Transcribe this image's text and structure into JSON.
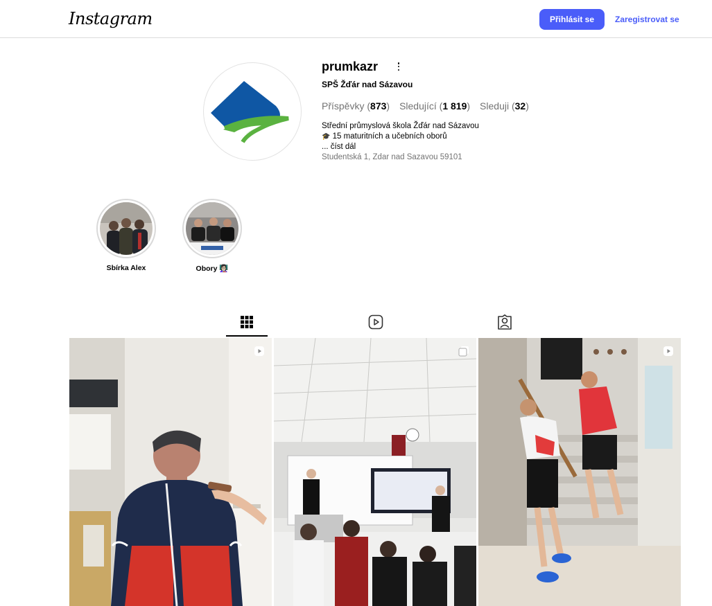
{
  "header": {
    "logo_text": "Instagram",
    "login_label": "Přihlásit se",
    "signup_label": "Zaregistrovat se",
    "accent_color": "#4a5df9"
  },
  "profile": {
    "username": "prumkazr",
    "full_name": "SPŠ Žďár nad Sázavou",
    "stats": {
      "posts_label": "Příspěvky",
      "posts_count": "873",
      "followers_label": "Sledující",
      "followers_count": "1 819",
      "following_label": "Sleduji",
      "following_count": "32"
    },
    "bio": {
      "line1": "Střední průmyslová škola Žďár nad Sázavou",
      "line2_icon": "🎓",
      "line2": "15 maturitních a učebních oborů",
      "more": "... číst dál",
      "address": "Studentská 1, Zdar nad Sazavou 59101"
    }
  },
  "highlights": [
    {
      "label": "Sbírka Alex"
    },
    {
      "label": "Obory 👩🏻‍🏫"
    }
  ],
  "tabs": [
    {
      "name": "posts",
      "icon": "grid-icon",
      "active": true
    },
    {
      "name": "reels",
      "icon": "reels-icon",
      "active": false
    },
    {
      "name": "tagged",
      "icon": "tagged-icon",
      "active": false
    }
  ],
  "posts": [
    {
      "type": "reel",
      "badge_icon": "reel-badge-icon"
    },
    {
      "type": "carousel",
      "badge_icon": "carousel-badge-icon"
    },
    {
      "type": "reel",
      "badge_icon": "reel-badge-icon"
    }
  ]
}
